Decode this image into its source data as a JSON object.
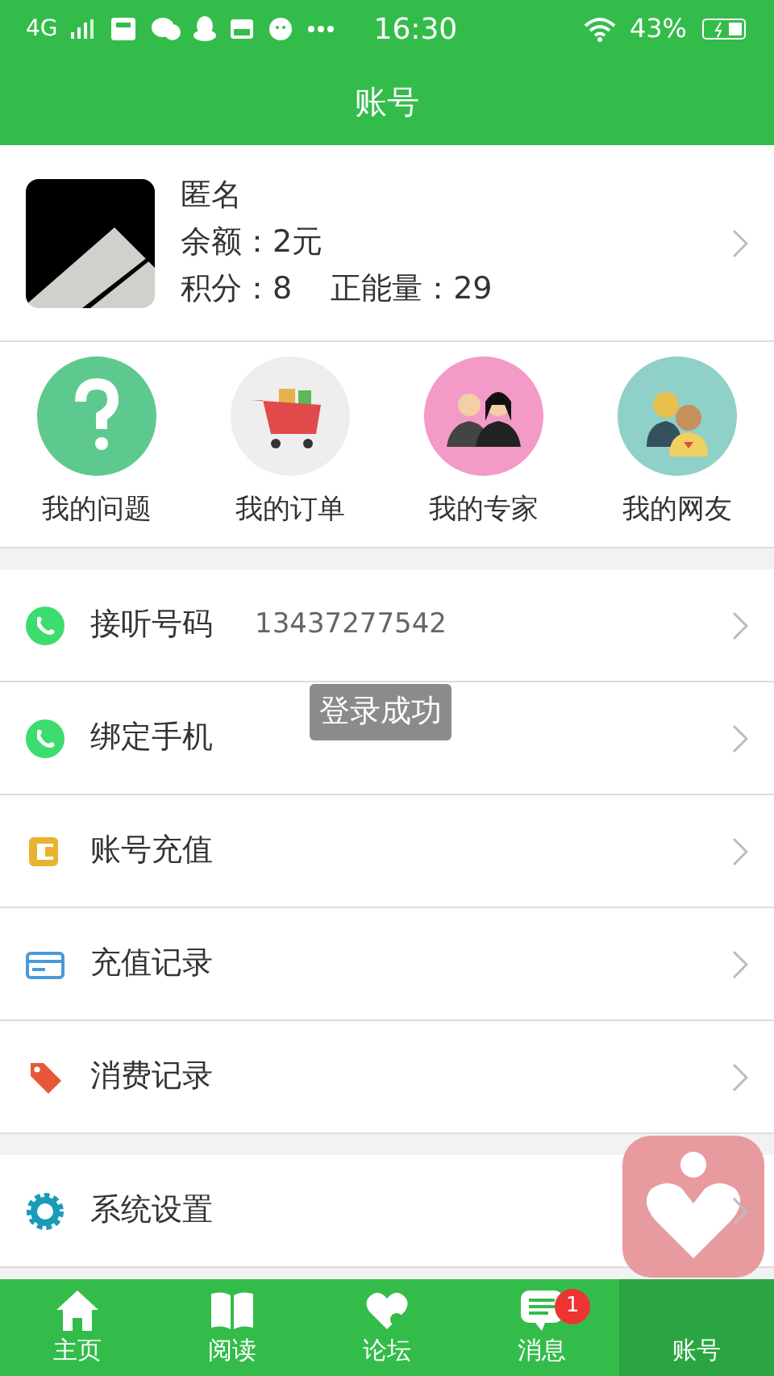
{
  "status_bar": {
    "network": "4G",
    "time": "16:30",
    "battery": "43%"
  },
  "header": {
    "title": "账号"
  },
  "profile": {
    "name": "匿名",
    "balance": "余额：2元",
    "points": "积分：8",
    "energy": "正能量：29"
  },
  "shortcuts": [
    {
      "label": "我的问题",
      "kind": "question"
    },
    {
      "label": "我的订单",
      "kind": "cart"
    },
    {
      "label": "我的专家",
      "kind": "experts"
    },
    {
      "label": "我的网友",
      "kind": "friends"
    }
  ],
  "menu_groups": [
    [
      {
        "label": "接听号码",
        "value": "13437277542",
        "kind": "phone"
      },
      {
        "label": "绑定手机",
        "kind": "phone"
      },
      {
        "label": "账号充值",
        "kind": "recharge"
      },
      {
        "label": "充值记录",
        "kind": "card"
      },
      {
        "label": "消费记录",
        "kind": "tag"
      }
    ],
    [
      {
        "label": "系统设置",
        "kind": "gear"
      }
    ]
  ],
  "toast": "登录成功",
  "tabs": [
    {
      "label": "主页",
      "kind": "home",
      "selected": false
    },
    {
      "label": "阅读",
      "kind": "book",
      "selected": false
    },
    {
      "label": "论坛",
      "kind": "forum",
      "selected": false
    },
    {
      "label": "消息",
      "kind": "message",
      "selected": false,
      "badge": "1"
    },
    {
      "label": "账号",
      "kind": "account",
      "selected": true
    }
  ]
}
